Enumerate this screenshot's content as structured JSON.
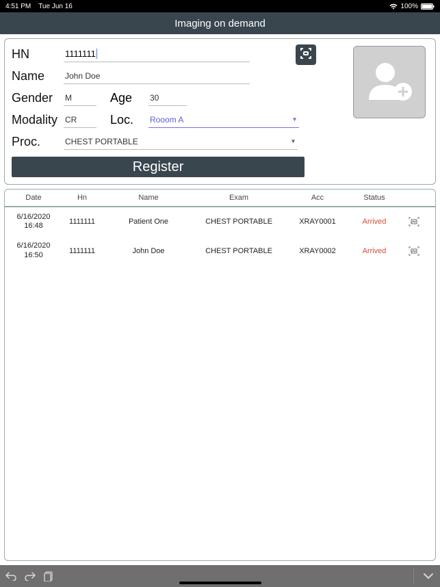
{
  "status": {
    "time": "4:51 PM",
    "date": "Tue Jun 16",
    "battery": "100%"
  },
  "header": {
    "title": "Imaging on demand"
  },
  "form": {
    "labels": {
      "hn": "HN",
      "name": "Name",
      "gender": "Gender",
      "age": "Age",
      "modality": "Modality",
      "loc": "Loc.",
      "proc": "Proc."
    },
    "values": {
      "hn": "1111111",
      "name": "John Doe",
      "gender": "M",
      "age": "30",
      "modality": "CR",
      "loc": "Rooom A",
      "proc": "CHEST PORTABLE"
    },
    "register_label": "Register"
  },
  "table": {
    "headers": {
      "date": "Date",
      "hn": "Hn",
      "name": "Name",
      "exam": "Exam",
      "acc": "Acc",
      "status": "Status"
    },
    "rows": [
      {
        "date": "6/16/2020",
        "time": "16:48",
        "hn": "1111111",
        "name": "Patient One",
        "exam": "CHEST PORTABLE",
        "acc": "XRAY0001",
        "status": "Arrived"
      },
      {
        "date": "6/16/2020",
        "time": "16:50",
        "hn": "1111111",
        "name": "John Doe",
        "exam": "CHEST PORTABLE",
        "acc": "XRAY0002",
        "status": "Arrived"
      }
    ]
  }
}
